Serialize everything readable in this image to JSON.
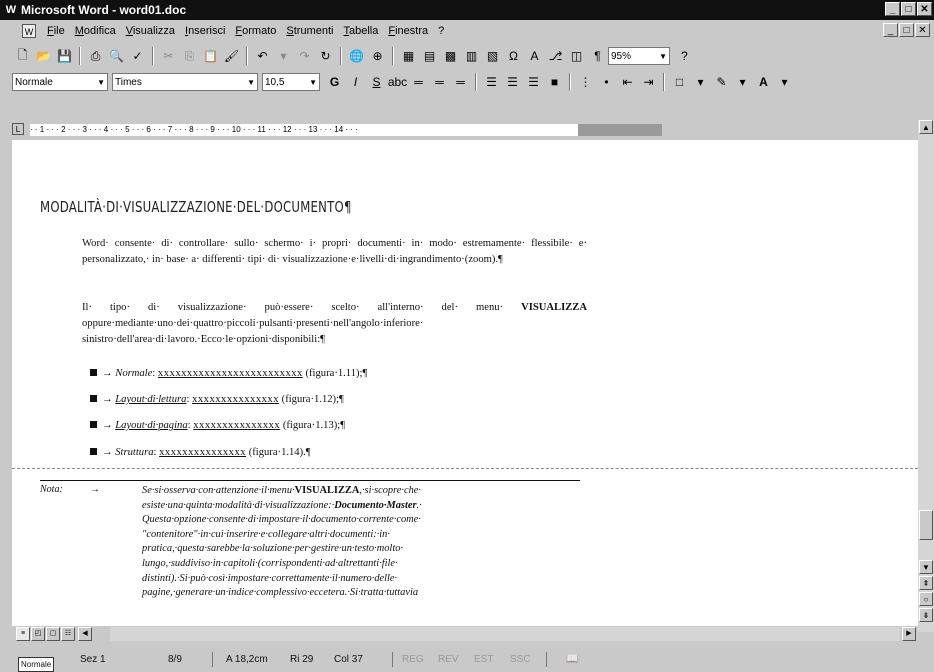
{
  "window": {
    "title": "Microsoft Word - word01.doc",
    "app_icon": "word-icon",
    "controls": [
      "minimize",
      "maximize",
      "close"
    ]
  },
  "menubar": {
    "items": [
      "File",
      "Modifica",
      "Visualizza",
      "Inserisci",
      "Formato",
      "Strumenti",
      "Tabella",
      "Finestra",
      "?"
    ]
  },
  "toolbar_standard": {
    "zoom": "95%"
  },
  "toolbar_formatting": {
    "style": "Normale",
    "font": "Times",
    "size": "10,5"
  },
  "ruler": {
    "scale": "· · 1 · · · 2 · · · 3 · · · 4 · · · 5 · · · 6 · · · 7 · · · 8 · · · 9 · · · 10 · · · 11 · · · 12 · · · 13 · · · 14 · · ·"
  },
  "document": {
    "heading": "MODALITÀ·DI·VISUALIZZAZIONE·DEL·DOCUMENTO¶",
    "para1": "Word· consente· di· controllare· sullo· schermo· i· propri· documenti· in· modo· estremamente· flessibile· e· personalizzato,· in· base· a· differenti· tipi· di· visualizzazione·e·livelli·di·ingrandimento·(zoom).¶",
    "para2_before": "Il· tipo· di· visualizzazione· può·essere· scelto· all'interno· del· menu· ",
    "para2_menu": "VISUALIZZA",
    "para2_after": " oppure·mediante·uno·dei·quattro·piccoli·pulsanti·presenti·nell'angolo·inferiore· sinistro·dell'area·di·lavoro.·Ecco·le·opzioni·disponibili:¶",
    "bullets": [
      {
        "name": "Normale",
        "code": "xxxxxxxxxxxxxxxxxxxxxxxxx",
        "ref": "(figura·1.11);¶"
      },
      {
        "name": "Layout·di·lettura",
        "code": "xxxxxxxxxxxxxxx",
        "ref": "(figura·1.12);¶"
      },
      {
        "name": "Layout·di·pagina",
        "code": "xxxxxxxxxxxxxxx",
        "ref": "(figura·1.13);¶"
      },
      {
        "name": "Struttura",
        "code": "xxxxxxxxxxxxxxx",
        "ref": "(figura·1.14).¶"
      }
    ],
    "note_label": "Nota:",
    "note_text_1": "Se·si·osserva·con·attenzione·il·menu·",
    "note_menu": "VISUALIZZA",
    "note_text_2": ",·si·scopre·che· esiste·una·quinta·modalità·di·visualizzazione:·",
    "note_mode": "Documento·Master",
    "note_text_3": ".· Questa·opzione·consente·di·impostare·il·documento·corrente·come· \"contenitore\"·in·cui·inserire·e·collegare·altri·documenti:·in· pratica,·questa·sarebbe·la·soluzione·per·gestire·un·testo·molto· lungo,·suddiviso·in·capitoli·(corrispondenti·ad·altrettanti·file· distinti).·Si·può·così·impostare·correttamente·il·numero·delle· pagine,·generare·un·indice·complessivo·eccetera.·Si·tratta·tuttavia"
  },
  "statusbar": {
    "tooltip": "Normale",
    "section": "Sez 1",
    "page": "8/9",
    "position": "A 18,2cm",
    "line": "Ri 29",
    "column": "Col 37",
    "modes": [
      "REG",
      "REV",
      "EST",
      "SSC"
    ],
    "language_icon": "book-icon"
  }
}
